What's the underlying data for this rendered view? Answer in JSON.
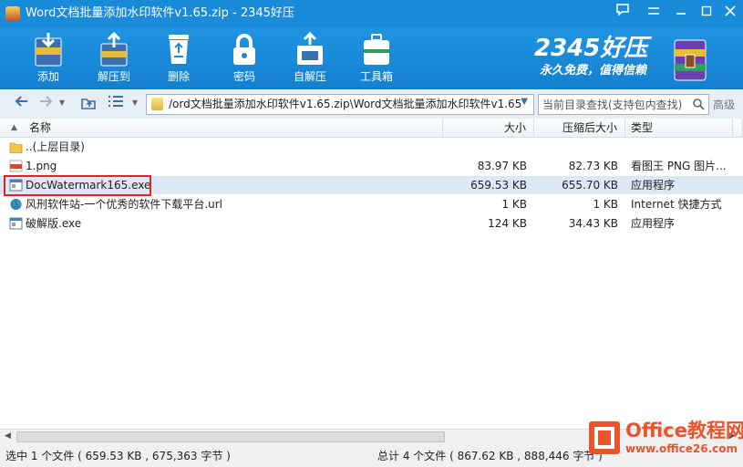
{
  "window": {
    "title": "Word文档批量添加水印软件v1.65.zip - 2345好压"
  },
  "toolbar": {
    "buttons": [
      {
        "label": "添加",
        "icon": "add-archive-icon"
      },
      {
        "label": "解压到",
        "icon": "extract-to-icon"
      },
      {
        "label": "删除",
        "icon": "recycle-bin-icon"
      },
      {
        "label": "密码",
        "icon": "padlock-icon"
      },
      {
        "label": "自解压",
        "icon": "self-extract-icon"
      },
      {
        "label": "工具箱",
        "icon": "toolbox-icon"
      }
    ]
  },
  "brand": {
    "logo": "2345好压",
    "slogan": "永久免费，值得信赖"
  },
  "address": {
    "path": "/ord文档批量添加水印软件v1.65.zip\\Word文档批量添加水印软件v1.65",
    "search_placeholder": "当前目录查找(支持包内查找)",
    "advanced": "高级"
  },
  "columns": {
    "name": "名称",
    "size": "大小",
    "compressed": "压缩后大小",
    "type": "类型"
  },
  "files": [
    {
      "name": "..(上层目录)",
      "size": "",
      "compressed": "",
      "type": "",
      "icon": "folder-icon",
      "selected": false
    },
    {
      "name": "1.png",
      "size": "83.97 KB",
      "compressed": "82.73 KB",
      "type": "看图王 PNG 图片...",
      "icon": "png-file-icon",
      "selected": false
    },
    {
      "name": "DocWatermark165.exe",
      "size": "659.53 KB",
      "compressed": "655.70 KB",
      "type": "应用程序",
      "icon": "exe-file-icon",
      "selected": true
    },
    {
      "name": "风刑软件站-一个优秀的软件下载平台.url",
      "size": "1 KB",
      "compressed": "1 KB",
      "type": "Internet 快捷方式",
      "icon": "globe-icon",
      "selected": false
    },
    {
      "name": "破解版.exe",
      "size": "124 KB",
      "compressed": "34.43 KB",
      "type": "应用程序",
      "icon": "exe-file-icon",
      "selected": false
    }
  ],
  "status": {
    "selected": "选中 1 个文件 ( 659.53 KB , 675,363 字节 )",
    "total": "总计 4 个文件 ( 867.62 KB , 888,446 字节 )"
  },
  "watermark": {
    "text": "Office教程网",
    "url": "www.office26.com"
  },
  "colors": {
    "titlebar": "#1a8bd9",
    "toolbar": "#1480cf",
    "selection": "#dde8f6",
    "highlight_border": "#d9262c",
    "watermark": "#e8552d"
  }
}
